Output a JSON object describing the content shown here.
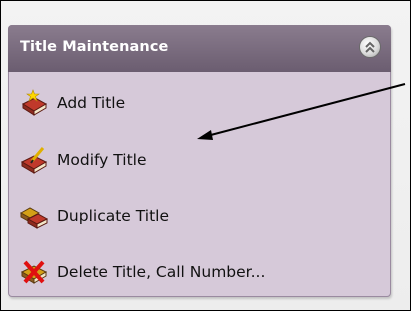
{
  "panel": {
    "title": "Title Maintenance",
    "collapse_icon": "double-chevron-up-icon",
    "items": [
      {
        "label": "Add Title",
        "icon": "book-sparkle-icon"
      },
      {
        "label": "Modify Title",
        "icon": "book-pencil-icon"
      },
      {
        "label": "Duplicate Title",
        "icon": "books-copy-icon"
      },
      {
        "label": "Delete Title, Call Number...",
        "icon": "book-delete-icon"
      }
    ]
  },
  "colors": {
    "panel_background": "#d6c9d9",
    "header_background": "#6b5d70",
    "header_text": "#ffffff"
  }
}
